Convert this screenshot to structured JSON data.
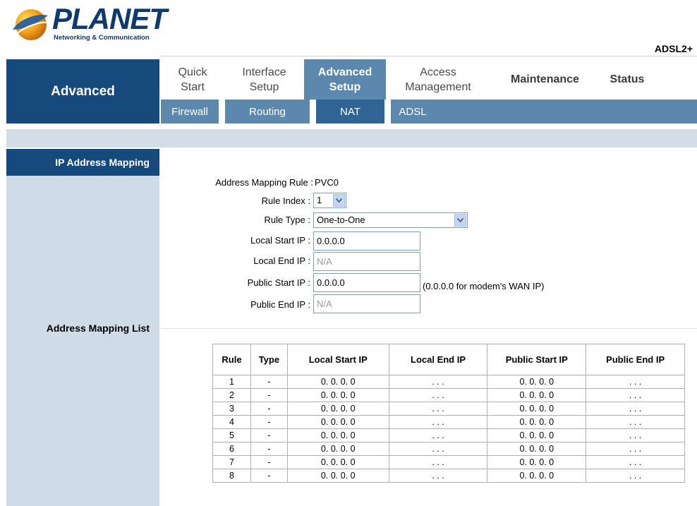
{
  "header": {
    "brand": "PLANET",
    "tagline": "Networking & Communication",
    "product": "ADSL2+"
  },
  "left": {
    "section_title": "Advanced",
    "subsection_title": "IP Address Mapping",
    "list_label": "Address Mapping List"
  },
  "nav": {
    "tabs": [
      {
        "line1": "Quick",
        "line2": "Start"
      },
      {
        "line1": "Interface",
        "line2": "Setup"
      },
      {
        "line1": "Advanced",
        "line2": "Setup"
      },
      {
        "line1": "Access",
        "line2": "Management"
      },
      {
        "line1": "Maintenance",
        "line2": ""
      },
      {
        "line1": "Status",
        "line2": ""
      }
    ],
    "active_tab": "Advanced Setup",
    "subtabs": [
      "Firewall",
      "Routing",
      "NAT",
      "ADSL"
    ],
    "active_subtab": "NAT"
  },
  "form": {
    "mapping_rule_label": "Address Mapping Rule :",
    "mapping_rule_value": "PVC0",
    "rule_index_label": "Rule Index :",
    "rule_index_value": "1",
    "rule_type_label": "Rule Type :",
    "rule_type_value": "One-to-One",
    "local_start_label": "Local Start IP :",
    "local_start_value": "0.0.0.0",
    "local_end_label": "Local End IP :",
    "local_end_value": "N/A",
    "public_start_label": "Public Start IP :",
    "public_start_value": "0.0.0.0",
    "public_start_hint": "(0.0.0.0 for modem's WAN IP)",
    "public_end_label": "Public End IP :",
    "public_end_value": "N/A"
  },
  "table": {
    "headers": [
      "Rule",
      "Type",
      "Local Start IP",
      "Local End IP",
      "Public Start IP",
      "Public End IP"
    ],
    "rows": [
      [
        "1",
        "-",
        "0. 0. 0. 0",
        ". . .",
        "0. 0. 0. 0",
        ". . ."
      ],
      [
        "2",
        "-",
        "0. 0. 0. 0",
        ". . .",
        "0. 0. 0. 0",
        ". . ."
      ],
      [
        "3",
        "-",
        "0. 0. 0. 0",
        ". . .",
        "0. 0. 0. 0",
        ". . ."
      ],
      [
        "4",
        "-",
        "0. 0. 0. 0",
        ". . .",
        "0. 0. 0. 0",
        ". . ."
      ],
      [
        "5",
        "-",
        "0. 0. 0. 0",
        ". . .",
        "0. 0. 0. 0",
        ". . ."
      ],
      [
        "6",
        "-",
        "0. 0. 0. 0",
        ". . .",
        "0. 0. 0. 0",
        ". . ."
      ],
      [
        "7",
        "-",
        "0. 0. 0. 0",
        ". . .",
        "0. 0. 0. 0",
        ". . ."
      ],
      [
        "8",
        "-",
        "0. 0. 0. 0",
        ". . .",
        "0. 0. 0. 0",
        ". . ."
      ]
    ]
  },
  "colors": {
    "dark_blue": "#174a7c",
    "nav_blue": "#5c88ad",
    "left_bar": "#cfdbe6"
  }
}
